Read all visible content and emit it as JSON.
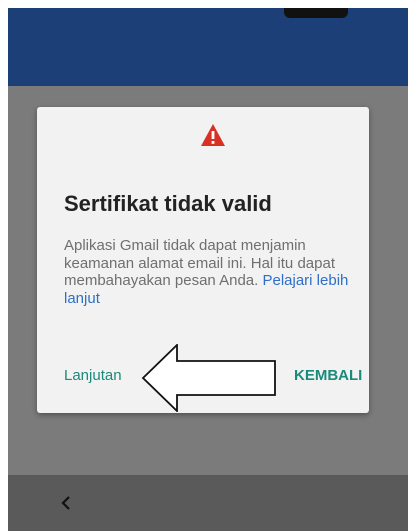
{
  "dialog": {
    "icon": "warning-triangle-icon",
    "title": "Sertifikat tidak valid",
    "message": "Aplikasi Gmail tidak dapat menjamin keamanan alamat email ini. Hal itu dapat membahayakan pesan Anda. ",
    "link": "Pelajari lebih lanjut",
    "continue_label": "Lanjutan",
    "back_label": "KEMBALI"
  },
  "annotation": {
    "icon": "left-arrow-outline-icon"
  },
  "navigation": {
    "back_icon": "chevron-left-icon",
    "back_glyph": "<"
  },
  "colors": {
    "app_bar": "#1c3f78",
    "overlay": "#7b7b7b",
    "dialog_bg": "#f2f2f2",
    "warning": "#d93025",
    "accent": "#1a8a7a",
    "link": "#2f6fc7"
  }
}
